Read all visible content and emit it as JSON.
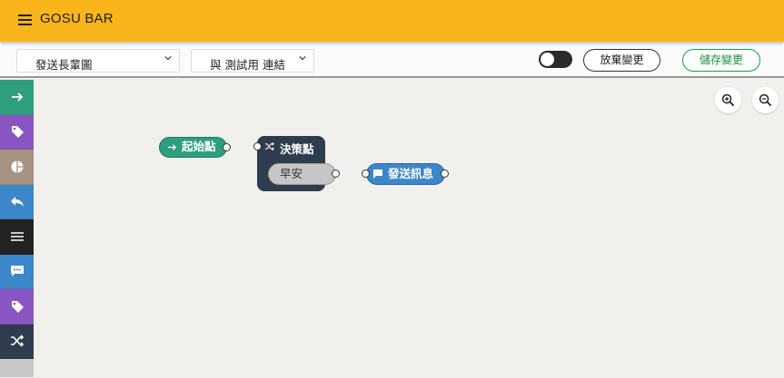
{
  "app": {
    "title": "GOSU BAR",
    "menu_icon": "hamburger-menu-icon"
  },
  "toolbar": {
    "flow_select": {
      "value": "發送長輩圖"
    },
    "link_select": {
      "value": "與 測試用 連結"
    },
    "toggle": {
      "on": false
    },
    "discard_label": "放棄變更",
    "save_label": "儲存變更"
  },
  "colors": {
    "appbar": "#fbb51c",
    "start_node": "#2e9e7f",
    "decision_node": "#2f3c4d",
    "send_node": "#3c87c9",
    "save_accent": "#1a8f3d"
  },
  "sidebar": {
    "items": [
      {
        "icon": "arrow-right-icon",
        "color": "#2e9e7f"
      },
      {
        "icon": "tag-icon",
        "color": "#8a55c0"
      },
      {
        "icon": "pie-chart-icon",
        "color": "#a89282"
      },
      {
        "icon": "reply-icon",
        "color": "#3c87c9"
      },
      {
        "icon": "lines-icon",
        "color": "#222222"
      },
      {
        "icon": "chat-dots-icon",
        "color": "#3c87c9"
      },
      {
        "icon": "tag-icon",
        "color": "#8a55c0"
      },
      {
        "icon": "shuffle-icon",
        "color": "#2f3c4d"
      }
    ]
  },
  "canvas": {
    "zoom_in_icon": "zoom-in-icon",
    "zoom_out_icon": "zoom-out-icon",
    "nodes": {
      "start": {
        "label": "起始點",
        "icon": "arrow-right-icon"
      },
      "decision": {
        "label": "決策點",
        "icon": "shuffle-icon",
        "option": "早安"
      },
      "send": {
        "label": "發送訊息",
        "icon": "chat-icon"
      }
    }
  }
}
